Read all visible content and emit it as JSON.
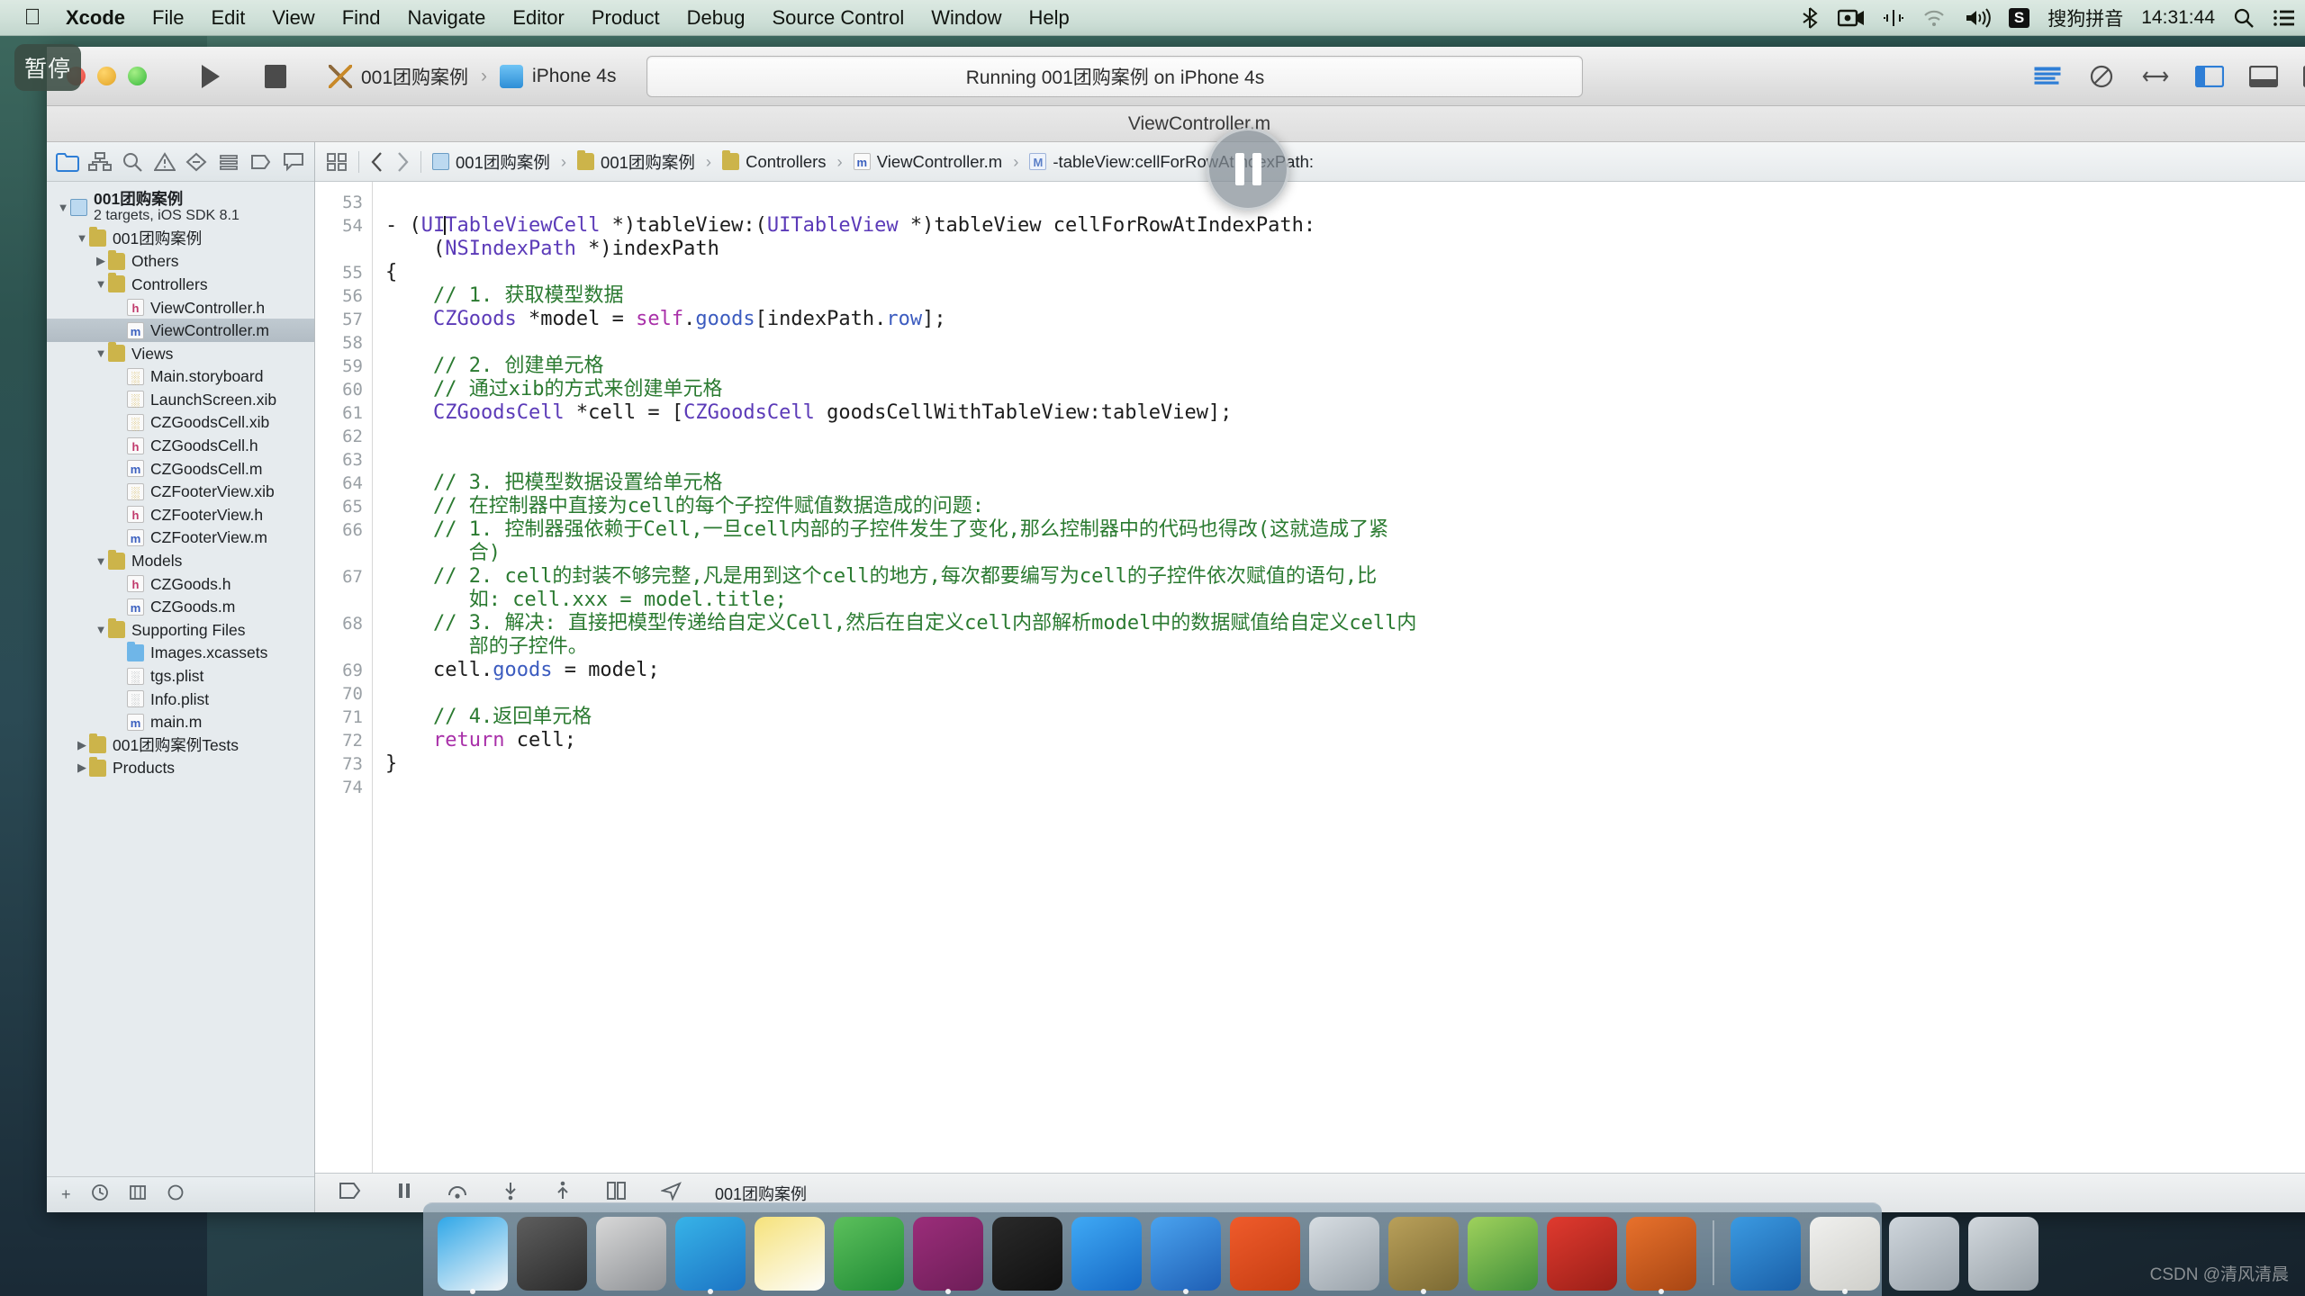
{
  "menubar": {
    "apple_icon": "apple-logo-icon",
    "items": [
      "Xcode",
      "File",
      "Edit",
      "View",
      "Find",
      "Navigate",
      "Editor",
      "Product",
      "Debug",
      "Source Control",
      "Window",
      "Help"
    ],
    "right": {
      "bluetooth_icon": "bluetooth-icon",
      "screenrecord_icon": "screen-record-icon",
      "airplay_icon": "airplay-icon",
      "wifi_icon": "wifi-icon",
      "volume_icon": "volume-icon",
      "ime_badge": "S",
      "ime_label": "搜狗拼音",
      "clock": "14:31:44",
      "search_icon": "spotlight-search-icon",
      "notification_icon": "notification-center-icon"
    }
  },
  "capture_hud": {
    "pause_label": "暂停"
  },
  "window": {
    "title": "ViewController.m",
    "traffic": {
      "close": "close-button",
      "minimize": "minimize-button",
      "zoom": "zoom-button"
    }
  },
  "toolbar": {
    "run_button": "Run",
    "stop_button": "Stop",
    "scheme_target": "001团购案例",
    "scheme_separator": "›",
    "scheme_device": "iPhone 4s",
    "status_text": "Running 001团购案例 on iPhone 4s",
    "right_icons": [
      "editor-standard-icon",
      "editor-assistant-icon",
      "editor-version-icon",
      "navigator-toggle-icon",
      "debug-toggle-icon",
      "utilities-toggle-icon"
    ]
  },
  "navigator": {
    "tabs": [
      "project-navigator-tab",
      "symbol-navigator-tab",
      "find-navigator-tab",
      "issue-navigator-tab",
      "test-navigator-tab",
      "debug-navigator-tab",
      "breakpoint-navigator-tab",
      "report-navigator-tab"
    ],
    "tree": [
      {
        "indent": 0,
        "twisty": "down",
        "icon": "project",
        "label": "001团购案例",
        "bold": true,
        "sub": "2 targets, iOS SDK 8.1"
      },
      {
        "indent": 1,
        "twisty": "down",
        "icon": "folder",
        "label": "001团购案例",
        "bold": false
      },
      {
        "indent": 2,
        "twisty": "right",
        "icon": "folder",
        "label": "Others",
        "bold": false
      },
      {
        "indent": 2,
        "twisty": "down",
        "icon": "folder",
        "label": "Controllers",
        "bold": false
      },
      {
        "indent": 3,
        "twisty": "none",
        "icon": "h",
        "label": "ViewController.h",
        "bold": false
      },
      {
        "indent": 3,
        "twisty": "none",
        "icon": "m",
        "label": "ViewController.m",
        "bold": false,
        "selected": true
      },
      {
        "indent": 2,
        "twisty": "down",
        "icon": "folder",
        "label": "Views",
        "bold": false
      },
      {
        "indent": 3,
        "twisty": "none",
        "icon": "xib",
        "label": "Main.storyboard",
        "bold": false
      },
      {
        "indent": 3,
        "twisty": "none",
        "icon": "xib",
        "label": "LaunchScreen.xib",
        "bold": false
      },
      {
        "indent": 3,
        "twisty": "none",
        "icon": "xib",
        "label": "CZGoodsCell.xib",
        "bold": false
      },
      {
        "indent": 3,
        "twisty": "none",
        "icon": "h",
        "label": "CZGoodsCell.h",
        "bold": false
      },
      {
        "indent": 3,
        "twisty": "none",
        "icon": "m",
        "label": "CZGoodsCell.m",
        "bold": false
      },
      {
        "indent": 3,
        "twisty": "none",
        "icon": "xib",
        "label": "CZFooterView.xib",
        "bold": false
      },
      {
        "indent": 3,
        "twisty": "none",
        "icon": "h",
        "label": "CZFooterView.h",
        "bold": false
      },
      {
        "indent": 3,
        "twisty": "none",
        "icon": "m",
        "label": "CZFooterView.m",
        "bold": false
      },
      {
        "indent": 2,
        "twisty": "down",
        "icon": "folder",
        "label": "Models",
        "bold": false
      },
      {
        "indent": 3,
        "twisty": "none",
        "icon": "h",
        "label": "CZGoods.h",
        "bold": false
      },
      {
        "indent": 3,
        "twisty": "none",
        "icon": "m",
        "label": "CZGoods.m",
        "bold": false
      },
      {
        "indent": 2,
        "twisty": "down",
        "icon": "folder",
        "label": "Supporting Files",
        "bold": false
      },
      {
        "indent": 3,
        "twisty": "none",
        "icon": "folderblue",
        "label": "Images.xcassets",
        "bold": false
      },
      {
        "indent": 3,
        "twisty": "none",
        "icon": "plist",
        "label": "tgs.plist",
        "bold": false
      },
      {
        "indent": 3,
        "twisty": "none",
        "icon": "plist",
        "label": "Info.plist",
        "bold": false
      },
      {
        "indent": 3,
        "twisty": "none",
        "icon": "m",
        "label": "main.m",
        "bold": false
      },
      {
        "indent": 1,
        "twisty": "right",
        "icon": "folder",
        "label": "001团购案例Tests",
        "bold": false
      },
      {
        "indent": 1,
        "twisty": "right",
        "icon": "folder",
        "label": "Products",
        "bold": false
      }
    ],
    "footer_icons": [
      "add-item-icon",
      "recent-filter-icon",
      "source-control-filter-icon",
      "warnings-filter-icon"
    ]
  },
  "jumpbar": {
    "icons": [
      "related-items-icon",
      "back-arrow-icon",
      "forward-arrow-icon"
    ],
    "breadcrumb": [
      {
        "icon": "project",
        "label": "001团购案例"
      },
      {
        "icon": "folder",
        "label": "001团购案例"
      },
      {
        "icon": "folder",
        "label": "Controllers"
      },
      {
        "icon": "m",
        "label": "ViewController.m"
      },
      {
        "icon": "method",
        "label": "-tableView:cellForRowAtIndexPath:"
      }
    ],
    "separator": "›"
  },
  "editor": {
    "line_numbers": [
      "53",
      "54",
      "",
      "55",
      "56",
      "57",
      "",
      "58",
      "59",
      "60",
      "61",
      "62",
      "",
      "63",
      "64",
      "65",
      "66",
      "",
      "67",
      "",
      "",
      "68",
      "",
      "",
      "69",
      "70",
      "",
      "71",
      "72",
      "73",
      "74"
    ],
    "lines": [
      {
        "n": "53",
        "segments": []
      },
      {
        "n": "54",
        "segments": [
          {
            "t": "- (",
            "c": ""
          },
          {
            "t": "UI",
            "c": "ty"
          },
          {
            "t": "|",
            "c": "caret"
          },
          {
            "t": "TableViewCell",
            "c": "ty"
          },
          {
            "t": " *)tableView:(",
            "c": ""
          },
          {
            "t": "UITableView",
            "c": "ty"
          },
          {
            "t": " *)tableView cellForRowAtIndexPath:",
            "c": ""
          }
        ]
      },
      {
        "n": "",
        "segments": [
          {
            "t": "    (",
            "c": ""
          },
          {
            "t": "NSIndexPath",
            "c": "ty"
          },
          {
            "t": " *)indexPath",
            "c": ""
          }
        ]
      },
      {
        "n": "55",
        "segments": [
          {
            "t": "{",
            "c": ""
          }
        ]
      },
      {
        "n": "56",
        "segments": [
          {
            "t": "    // 1. 获取模型数据",
            "c": "cm"
          }
        ]
      },
      {
        "n": "57",
        "segments": [
          {
            "t": "    ",
            "c": ""
          },
          {
            "t": "CZGoods",
            "c": "ty"
          },
          {
            "t": " *model = ",
            "c": ""
          },
          {
            "t": "self",
            "c": "kw"
          },
          {
            "t": ".",
            "c": ""
          },
          {
            "t": "goods",
            "c": "pr"
          },
          {
            "t": "[indexPath.",
            "c": ""
          },
          {
            "t": "row",
            "c": "pr"
          },
          {
            "t": "];",
            "c": ""
          }
        ]
      },
      {
        "n": "58",
        "segments": []
      },
      {
        "n": "59",
        "segments": [
          {
            "t": "    // 2. 创建单元格",
            "c": "cm"
          }
        ]
      },
      {
        "n": "60",
        "segments": [
          {
            "t": "    // 通过xib的方式来创建单元格",
            "c": "cm"
          }
        ]
      },
      {
        "n": "61",
        "segments": [
          {
            "t": "    ",
            "c": ""
          },
          {
            "t": "CZGoodsCell",
            "c": "ty"
          },
          {
            "t": " *cell = [",
            "c": ""
          },
          {
            "t": "CZGoodsCell",
            "c": "ty"
          },
          {
            "t": " goodsCellWithTableView:tableView];",
            "c": ""
          }
        ]
      },
      {
        "n": "62",
        "segments": []
      },
      {
        "n": "63",
        "segments": []
      },
      {
        "n": "64",
        "segments": [
          {
            "t": "    // 3. 把模型数据设置给单元格",
            "c": "cm"
          }
        ]
      },
      {
        "n": "65",
        "segments": [
          {
            "t": "    // 在控制器中直接为cell的每个子控件赋值数据造成的问题:",
            "c": "cm"
          }
        ]
      },
      {
        "n": "66",
        "segments": [
          {
            "t": "    // 1. 控制器强依赖于Cell,一旦cell内部的子控件发生了变化,那么控制器中的代码也得改(这就造成了紧",
            "c": "cm"
          }
        ]
      },
      {
        "n": "",
        "segments": [
          {
            "t": "       合)",
            "c": "cm"
          }
        ]
      },
      {
        "n": "67",
        "segments": [
          {
            "t": "    // 2. cell的封装不够完整,凡是用到这个cell的地方,每次都要编写为cell的子控件依次赋值的语句,比",
            "c": "cm"
          }
        ]
      },
      {
        "n": "",
        "segments": [
          {
            "t": "       如: cell.xxx = model.title;",
            "c": "cm"
          }
        ]
      },
      {
        "n": "68",
        "segments": [
          {
            "t": "    // 3. 解决: 直接把模型传递给自定义Cell,然后在自定义cell内部解析model中的数据赋值给自定义cell内",
            "c": "cm"
          }
        ]
      },
      {
        "n": "",
        "segments": [
          {
            "t": "       部的子控件。",
            "c": "cm"
          }
        ]
      },
      {
        "n": "69",
        "segments": [
          {
            "t": "    cell.",
            "c": ""
          },
          {
            "t": "goods",
            "c": "pr"
          },
          {
            "t": " = model;",
            "c": ""
          }
        ]
      },
      {
        "n": "70",
        "segments": []
      },
      {
        "n": "71",
        "segments": [
          {
            "t": "    // 4.返回单元格",
            "c": "cm"
          }
        ]
      },
      {
        "n": "72",
        "segments": [
          {
            "t": "    ",
            "c": ""
          },
          {
            "t": "return",
            "c": "kw"
          },
          {
            "t": " cell;",
            "c": ""
          }
        ]
      },
      {
        "n": "73",
        "segments": [
          {
            "t": "}",
            "c": ""
          }
        ]
      },
      {
        "n": "74",
        "segments": []
      }
    ]
  },
  "bottombar": {
    "icons": [
      "breakpoint-toggle-icon",
      "continue-icon",
      "step-over-icon",
      "step-into-icon",
      "step-out-icon",
      "view-hierarchy-icon",
      "location-simulate-icon"
    ],
    "process_label": "001团购案例"
  },
  "dock": {
    "items": [
      {
        "name": "finder-icon",
        "color1": "#2fa7e8",
        "color2": "#f4f6f8"
      },
      {
        "name": "system-preferences-icon",
        "color1": "#5e5e5e",
        "color2": "#2a2a2a"
      },
      {
        "name": "launchpad-icon",
        "color1": "#d8d8d8",
        "color2": "#8f9296"
      },
      {
        "name": "safari-icon",
        "color1": "#37b3e8",
        "color2": "#1c74c4"
      },
      {
        "name": "notes-icon",
        "color1": "#f6e27a",
        "color2": "#fdfdfa"
      },
      {
        "name": "excel-icon",
        "color1": "#5cc05c",
        "color2": "#1f8a35"
      },
      {
        "name": "onenote-icon",
        "color1": "#9b2d7a",
        "color2": "#6e1e58"
      },
      {
        "name": "terminal-icon",
        "color1": "#2a2a2a",
        "color2": "#101010"
      },
      {
        "name": "xcode-icon",
        "color1": "#3fa9f5",
        "color2": "#1668c4"
      },
      {
        "name": "instruments-icon",
        "color1": "#4aa3ef",
        "color2": "#1f5fb5"
      },
      {
        "name": "help-viewer-icon",
        "color1": "#ef5b2b",
        "color2": "#c63d12"
      },
      {
        "name": "scissors-icon",
        "color1": "#d7dde2",
        "color2": "#9aa3ab"
      },
      {
        "name": "utility-icon",
        "color1": "#b9a05a",
        "color2": "#7c6a33"
      },
      {
        "name": "browser-icon",
        "color1": "#9fd15c",
        "color2": "#3f8f3a"
      },
      {
        "name": "filezilla-icon",
        "color1": "#e03a2f",
        "color2": "#9a1f17"
      },
      {
        "name": "torch-icon",
        "color1": "#e8712c",
        "color2": "#a84613"
      },
      {
        "name": "divider",
        "color1": "",
        "color2": ""
      },
      {
        "name": "sketch-app-icon",
        "color1": "#3b9ae1",
        "color2": "#1a5fa8"
      },
      {
        "name": "documents-stack-icon",
        "color1": "#f0f0ee",
        "color2": "#cfcfca"
      },
      {
        "name": "downloads-stack-icon",
        "color1": "#cfd6dc",
        "color2": "#9aa3ab"
      },
      {
        "name": "trash-icon",
        "color1": "#d2d8dd",
        "color2": "#98a1a8"
      }
    ]
  },
  "watermark": {
    "text": "CSDN @清风清晨"
  }
}
